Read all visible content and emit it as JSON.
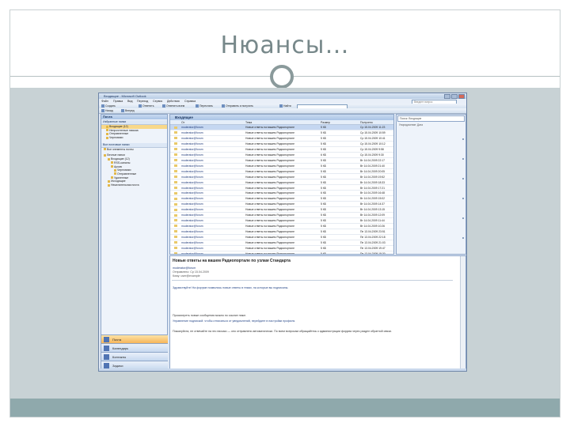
{
  "slide": {
    "title": "Нюансы…"
  },
  "window": {
    "title": "Входящие - Microsoft Outlook",
    "menu": [
      "Файл",
      "Правка",
      "Вид",
      "Переход",
      "Сервис",
      "Действия",
      "Справка"
    ],
    "toolbar1": [
      "Создать",
      "Ответить",
      "Ответить всем",
      "Переслать",
      "Отправить и получить",
      "Найти"
    ],
    "toolbar2": [
      "Назад",
      "Вперед"
    ],
    "help_placeholder": "Введите вопрос"
  },
  "nav": {
    "header": "Почта",
    "favorites_label": "Избранные папки",
    "favorites": [
      "Входящие (12)",
      "Непрочтенные письма",
      "Отправленные",
      "Черновики"
    ],
    "all_folders_label": "Все почтовые папки",
    "all_items": [
      "Все элементы почты",
      "Личные папки",
      "Входящие (12)",
      "RSS-каналы",
      "Архив",
      "Черновики",
      "Отправленные",
      "Удаленные",
      "Исходящие",
      "Нежелательная почта"
    ],
    "buttons": [
      "Почта",
      "Календарь",
      "Контакты",
      "Задачи"
    ]
  },
  "list": {
    "header": "Входящие",
    "columns": [
      "От",
      "Тема",
      "Размер",
      "Получено"
    ],
    "rows": [
      {
        "from": "moderator@forum",
        "subject": "Новые ответы на вашем Радиопортале",
        "size": "5 КБ",
        "date": "Ср 15.04.2009 11:23"
      },
      {
        "from": "moderator@forum",
        "subject": "Новые ответы на вашем Радиопортале",
        "size": "5 КБ",
        "date": "Ср 15.04.2009 10:59"
      },
      {
        "from": "moderator@forum",
        "subject": "Новые ответы на вашем Радиопортале",
        "size": "5 КБ",
        "date": "Ср 15.04.2009 10:41"
      },
      {
        "from": "moderator@forum",
        "subject": "Новые ответы на вашем Радиопортале",
        "size": "5 КБ",
        "date": "Ср 15.04.2009 10:12"
      },
      {
        "from": "moderator@forum",
        "subject": "Новые ответы на вашем Радиопортале",
        "size": "5 КБ",
        "date": "Ср 15.04.2009 9:58"
      },
      {
        "from": "moderator@forum",
        "subject": "Новые ответы на вашем Радиопортале",
        "size": "6 КБ",
        "date": "Ср 15.04.2009 9:30"
      },
      {
        "from": "moderator@forum",
        "subject": "Новые ответы на вашем Радиопортале",
        "size": "5 КБ",
        "date": "Вт 14.04.2009 22:17"
      },
      {
        "from": "moderator@forum",
        "subject": "Новые ответы на вашем Радиопортале",
        "size": "5 КБ",
        "date": "Вт 14.04.2009 21:40"
      },
      {
        "from": "moderator@forum",
        "subject": "Новые ответы на вашем Радиопортале",
        "size": "5 КБ",
        "date": "Вт 14.04.2009 20:05"
      },
      {
        "from": "moderator@forum",
        "subject": "Новые ответы на вашем Радиопортале",
        "size": "5 КБ",
        "date": "Вт 14.04.2009 19:52"
      },
      {
        "from": "moderator@forum",
        "subject": "Новые ответы на вашем Радиопортале",
        "size": "5 КБ",
        "date": "Вт 14.04.2009 18:33"
      },
      {
        "from": "moderator@forum",
        "subject": "Новые ответы на вашем Радиопортале",
        "size": "5 КБ",
        "date": "Вт 14.04.2009 17:21"
      },
      {
        "from": "moderator@forum",
        "subject": "Новые ответы на вашем Радиопортале",
        "size": "6 КБ",
        "date": "Вт 14.04.2009 16:48"
      },
      {
        "from": "moderator@forum",
        "subject": "Новые ответы на вашем Радиопортале",
        "size": "5 КБ",
        "date": "Вт 14.04.2009 15:02"
      },
      {
        "from": "moderator@forum",
        "subject": "Новые ответы на вашем Радиопортале",
        "size": "5 КБ",
        "date": "Вт 14.04.2009 14:37"
      },
      {
        "from": "moderator@forum",
        "subject": "Новые ответы на вашем Радиопортале",
        "size": "5 КБ",
        "date": "Вт 14.04.2009 13:15"
      },
      {
        "from": "moderator@forum",
        "subject": "Новые ответы на вашем Радиопортале",
        "size": "5 КБ",
        "date": "Вт 14.04.2009 12:09"
      },
      {
        "from": "moderator@forum",
        "subject": "Новые ответы на вашем Радиопортале",
        "size": "5 КБ",
        "date": "Вт 14.04.2009 11:44"
      },
      {
        "from": "moderator@forum",
        "subject": "Новые ответы на вашем Радиопортале",
        "size": "5 КБ",
        "date": "Вт 14.04.2009 10:26"
      },
      {
        "from": "moderator@forum",
        "subject": "Новые ответы на вашем Радиопортале",
        "size": "5 КБ",
        "date": "Пн 13.04.2009 23:51"
      },
      {
        "from": "moderator@forum",
        "subject": "Новые ответы на вашем Радиопортале",
        "size": "5 КБ",
        "date": "Пн 13.04.2009 22:18"
      },
      {
        "from": "moderator@forum",
        "subject": "Новые ответы на вашем Радиопортале",
        "size": "5 КБ",
        "date": "Пн 13.04.2009 21:03"
      },
      {
        "from": "moderator@forum",
        "subject": "Новые ответы на вашем Радиопортале",
        "size": "5 КБ",
        "date": "Пн 13.04.2009 19:47"
      },
      {
        "from": "moderator@forum",
        "subject": "Новые ответы на вашем Радиопортале",
        "size": "5 КБ",
        "date": "Пн 13.04.2009 18:30"
      },
      {
        "from": "moderator@forum",
        "subject": "Новые ответы на вашем Радиопортале",
        "size": "5 КБ",
        "date": "Пн 13.04.2009 17:12"
      }
    ]
  },
  "todo": {
    "search_placeholder": "Поиск: Входящие",
    "sort_label": "Упорядочение: Дата"
  },
  "reading": {
    "title": "Новые ответы на вашем Радиопортале по узлам Стандарта",
    "from": "moderator@forum",
    "sent": "Отправлено: Ср 15.04.2009",
    "to": "Кому: user@example",
    "body1": "Здравствуйте! На форуме появились новые ответы в темах, на которые вы подписаны.",
    "body2": "Просмотреть новые сообщения можно по ссылке ниже.",
    "body3": "Управление подпиской: чтобы отписаться от уведомлений, перейдите в настройки профиля.",
    "body4": "Пожалуйста, не отвечайте на это письмо — оно отправлено автоматически. По всем вопросам обращайтесь к администрации форума через раздел обратной связи."
  },
  "colors": {
    "slide_band": "#c8d2d5",
    "footer_band": "#8fa9ac",
    "title_text": "#77888a"
  }
}
